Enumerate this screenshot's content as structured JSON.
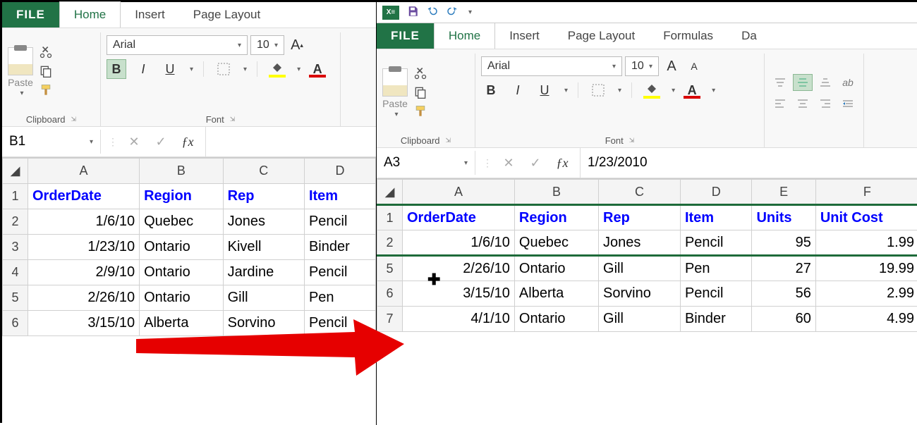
{
  "left": {
    "tabs": {
      "file": "FILE",
      "home": "Home",
      "insert": "Insert",
      "pagelayout": "Page Layout"
    },
    "clipboard": {
      "paste": "Paste",
      "label": "Clipboard"
    },
    "font": {
      "name": "Arial",
      "size": "10",
      "bold": "B",
      "italic": "I",
      "underline": "U",
      "label": "Font"
    },
    "namebox": "B1",
    "formula": "",
    "cols": [
      "A",
      "B",
      "C",
      "D"
    ],
    "rows": [
      "1",
      "2",
      "3",
      "4",
      "5",
      "6"
    ],
    "data": [
      [
        "OrderDate",
        "Region",
        "Rep",
        "Item"
      ],
      [
        "1/6/10",
        "Quebec",
        "Jones",
        "Pencil"
      ],
      [
        "1/23/10",
        "Ontario",
        "Kivell",
        "Binder"
      ],
      [
        "2/9/10",
        "Ontario",
        "Jardine",
        "Pencil"
      ],
      [
        "2/26/10",
        "Ontario",
        "Gill",
        "Pen"
      ],
      [
        "3/15/10",
        "Alberta",
        "Sorvino",
        "Pencil"
      ]
    ]
  },
  "right": {
    "tabs": {
      "file": "FILE",
      "home": "Home",
      "insert": "Insert",
      "pagelayout": "Page Layout",
      "formulas": "Formulas",
      "data": "Da"
    },
    "clipboard": {
      "paste": "Paste",
      "label": "Clipboard"
    },
    "font": {
      "name": "Arial",
      "size": "10",
      "bold": "B",
      "italic": "I",
      "underline": "U",
      "grow": "A",
      "shrink": "A",
      "label": "Font"
    },
    "namebox": "A3",
    "formula": "1/23/2010",
    "cols": [
      "A",
      "B",
      "C",
      "D",
      "E",
      "F"
    ],
    "rows_top": [
      "1",
      "2"
    ],
    "rows_bottom": [
      "5",
      "6",
      "7"
    ],
    "data_top": [
      [
        "OrderDate",
        "Region",
        "Rep",
        "Item",
        "Units",
        "Unit Cost"
      ],
      [
        "1/6/10",
        "Quebec",
        "Jones",
        "Pencil",
        "95",
        "1.99"
      ]
    ],
    "data_bottom": [
      [
        "2/26/10",
        "Ontario",
        "Gill",
        "Pen",
        "27",
        "19.99"
      ],
      [
        "3/15/10",
        "Alberta",
        "Sorvino",
        "Pencil",
        "56",
        "2.99"
      ],
      [
        "4/1/10",
        "Ontario",
        "Gill",
        "Binder",
        "60",
        "4.99"
      ]
    ]
  }
}
